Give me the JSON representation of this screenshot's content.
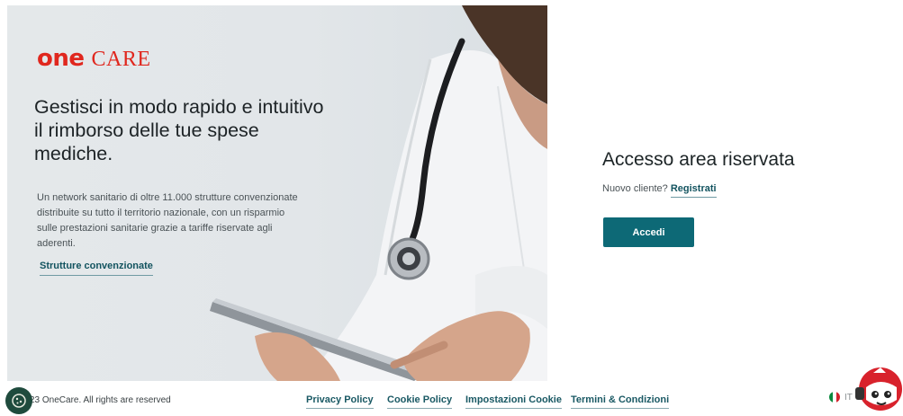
{
  "brand": {
    "one": "one",
    "care": "CARE",
    "color": "#e0271e"
  },
  "hero": {
    "headline": "Gestisci in modo rapido e intuitivo il rimborso delle tue spese mediche.",
    "description": "Un network sanitario di oltre 11.000 strutture convenzionate distribuite su tutto il territorio nazionale, con un risparmio sulle prestazioni sanitarie grazie a tariffe riservate agli aderenti.",
    "link_label": "Strutture convenzionate"
  },
  "login": {
    "title": "Accesso area riservata",
    "new_client": "Nuovo cliente?",
    "register_label": "Registrati",
    "button_label": "Accedi",
    "accent": "#0d6976"
  },
  "footer": {
    "copyright": "23 OneCare. All rights are reserved",
    "links": [
      "Privacy Policy",
      "Cookie Policy",
      "Impostazioni Cookie",
      "Termini & Condizioni"
    ],
    "language": "IT"
  },
  "icons": {
    "cookie": "cookie-icon",
    "flag": "italy-flag-icon",
    "mascot": "chat-mascot-icon"
  }
}
